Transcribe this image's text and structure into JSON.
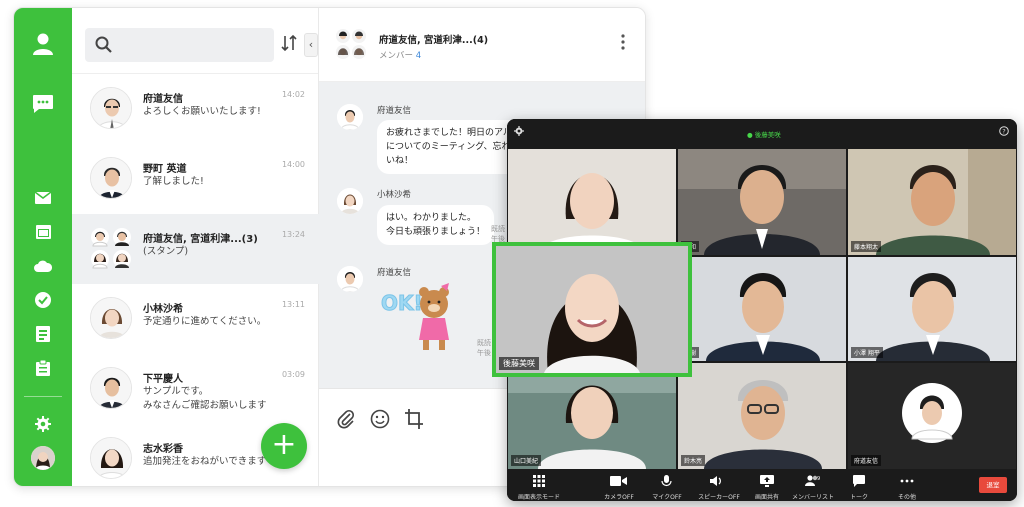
{
  "colors": {
    "brand_green": "#3ec13d",
    "exit_red": "#e84a3c",
    "link_blue": "#3b86d8"
  },
  "rail": {
    "icons": [
      "person-icon",
      "chat-icon",
      "mail-icon",
      "calendar-icon",
      "cloud-icon",
      "check-icon",
      "task-icon",
      "note-icon",
      "gear-icon"
    ]
  },
  "chat_list": [
    {
      "name": "府道友信",
      "message": "よろしくお願いいたします!",
      "time": "14:02"
    },
    {
      "name": "野町 英道",
      "message": "了解しました!",
      "time": "14:00"
    },
    {
      "name": "府道友信, 宮道利津...(3)",
      "message": "(スタンプ)",
      "time": "13:24"
    },
    {
      "name": "小林沙希",
      "message": "予定通りに進めてください。",
      "time": "13:11"
    },
    {
      "name": "下平慶人",
      "message": "サンプルです。",
      "message2": "みなさんご確認お願いします",
      "time": "03:09"
    },
    {
      "name": "志水彩香",
      "message": "追加発注をおねがいできます",
      "time": ""
    }
  ],
  "chat": {
    "title": "府道友信, 宮道利津...(4)",
    "members_label": "メンバー",
    "members_count": "4",
    "messages": [
      {
        "sender": "府道友信",
        "lines": [
          "お疲れさまでした！明日のアル",
          "についてのミーティング、忘れず",
          "いね！"
        ]
      },
      {
        "sender": "小林沙希",
        "lines": [
          "はい。わかりました。",
          "今日も頑張りましょう！"
        ],
        "meta": [
          "既読",
          "午後"
        ]
      },
      {
        "sender": "府道友信",
        "sticker_text": "OK!",
        "meta": [
          "既読 3",
          "午後 1:"
        ]
      }
    ]
  },
  "video_call": {
    "speaking_label": "後藤美咲",
    "featured_name": "後藤美咲",
    "tiles": [
      {
        "tag": ""
      },
      {
        "tag": "大和"
      },
      {
        "tag": "藤本翔太"
      },
      {
        "tag": "英樹"
      },
      {
        "tag": "小澤 翔平"
      },
      {
        "tag": "山口美紀"
      },
      {
        "tag": "鈴木亮"
      },
      {
        "tag": "府道友信"
      }
    ],
    "controls": [
      {
        "label": "画面表示モード",
        "icon": "grid-icon"
      },
      {
        "label": "カメラOFF",
        "icon": "camera-icon"
      },
      {
        "label": "マイクOFF",
        "icon": "mic-icon"
      },
      {
        "label": "スピーカーOFF",
        "icon": "speaker-icon"
      },
      {
        "label": "画面共有",
        "icon": "screen-share-icon"
      },
      {
        "label": "メンバーリスト",
        "icon": "members-icon"
      },
      {
        "label": "トーク",
        "icon": "talk-icon"
      },
      {
        "label": "その他",
        "icon": "more-icon"
      }
    ],
    "member_badge": "9",
    "exit_label": "退室"
  }
}
